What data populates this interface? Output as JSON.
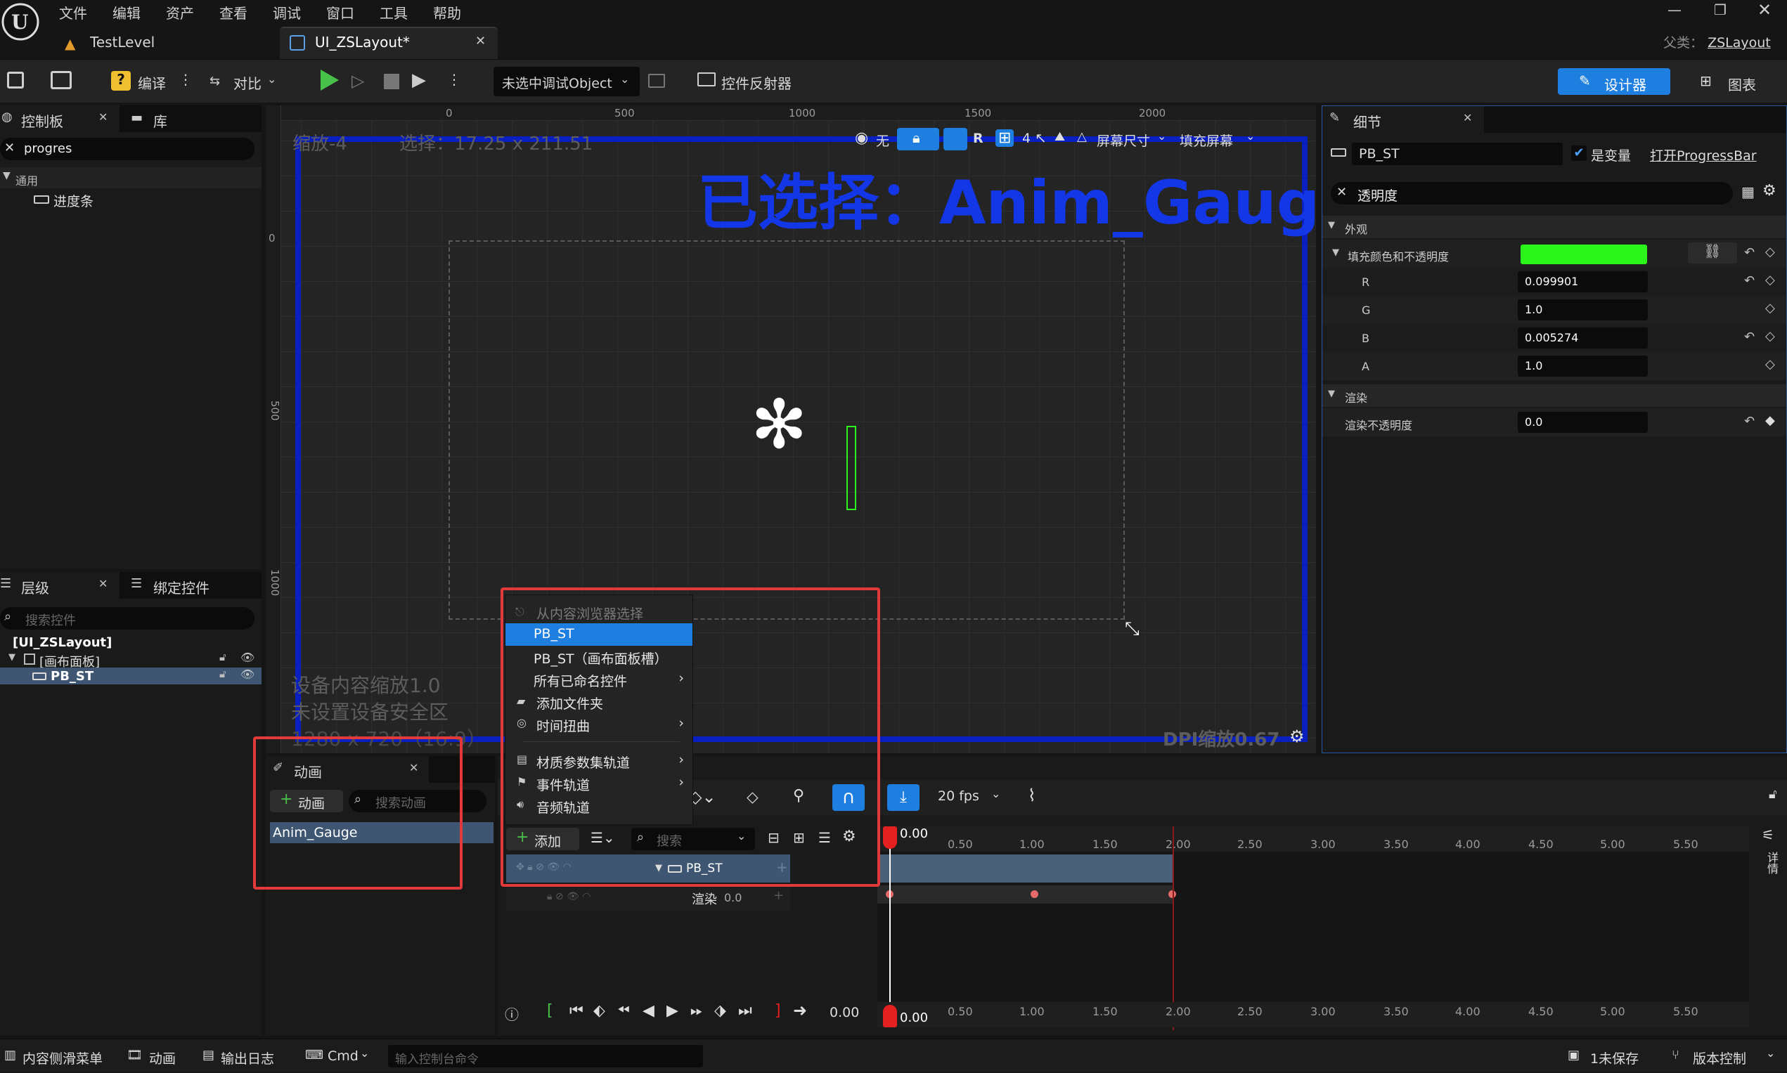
{
  "menu": [
    "文件",
    "编辑",
    "资产",
    "查看",
    "调试",
    "窗口",
    "工具",
    "帮助"
  ],
  "tabs": [
    {
      "label": "TestLevel"
    },
    {
      "label": "UI_ZSLayout*"
    }
  ],
  "parent": {
    "label": "父类：",
    "value": "ZSLayout"
  },
  "toolbar": {
    "compile": "编译",
    "diff": "对比",
    "debug_select": "未选中调试Object",
    "reflector": "控件反射器",
    "designer": "设计器",
    "graph": "图表"
  },
  "palette": {
    "tab": "控制板",
    "tab2": "库",
    "search_value": "progres",
    "category": "通用",
    "item": "进度条"
  },
  "hierarchy": {
    "tab": "层级",
    "tab2": "绑定控件",
    "search_placeholder": "搜索控件",
    "root": "[UI_ZSLayout]",
    "canvas": "[画布面板]",
    "item": "PB_ST"
  },
  "viewport": {
    "zoom": "缩放-4",
    "selection": "选择：17.25 x 211.51",
    "selected_big": "已选择：Anim_Gauge",
    "ruler_top": [
      "0",
      "500",
      "1000",
      "1500",
      "2000"
    ],
    "ruler_left": [
      "0",
      "500",
      "1000"
    ],
    "none_label": "无",
    "r_label": "R",
    "grid_num": "4",
    "screen_size": "屏幕尺寸",
    "fill_screen": "填充屏幕",
    "device_scale": "设备内容缩放1.0",
    "no_safe_zone": "未设置设备安全区",
    "resolution": "1280 x 720（16:9）",
    "dpi": "DPI缩放0.67"
  },
  "details": {
    "tab": "细节",
    "name": "PB_ST",
    "is_variable": "是变量",
    "open_link": "打开ProgressBar",
    "search_value": "透明度",
    "section_appearance": "外观",
    "fill_label": "填充颜色和不透明度",
    "fill_color": "#2bf51a",
    "r_label": "R",
    "r_value": "0.099901",
    "g_label": "G",
    "g_value": "1.0",
    "b_label": "B",
    "b_value": "0.005274",
    "a_label": "A",
    "a_value": "1.0",
    "section_render": "渲染",
    "opacity_label": "渲染不透明度",
    "opacity_value": "0.0"
  },
  "animation": {
    "tab": "动画",
    "add_label": "动画",
    "search_placeholder": "搜索动画",
    "item": "Anim_Gauge"
  },
  "context_menu": {
    "items": [
      {
        "label": "从内容浏览器选择",
        "state": "disabled"
      },
      {
        "label": "PB_ST",
        "state": "highlighted"
      },
      {
        "label": "PB_ST（画布面板槽）",
        "state": "normal"
      },
      {
        "label": "所有已命名控件",
        "state": "submenu"
      },
      {
        "label": "添加文件夹",
        "state": "normal"
      },
      {
        "label": "时间扭曲",
        "state": "submenu"
      },
      {
        "label": "材质参数集轨道",
        "state": "submenu"
      },
      {
        "label": "事件轨道",
        "state": "submenu"
      },
      {
        "label": "音频轨道",
        "state": "normal"
      }
    ]
  },
  "sequencer": {
    "add_label": "添加",
    "search_placeholder": "搜索",
    "fps": "20 fps",
    "track": "PB_ST",
    "sub_track": "渲染",
    "sub_value": "0.0",
    "time_start": "0.00",
    "current_time": "0.00",
    "ticks": [
      "0.50",
      "1.00",
      "1.50",
      "2.00",
      "2.50",
      "3.00",
      "3.50",
      "4.00",
      "4.50",
      "5.00",
      "5.50"
    ],
    "side_label": "详情"
  },
  "statusbar": {
    "drawer": "内容侧滑菜单",
    "anim": "动画",
    "log": "输出日志",
    "cmd": "Cmd",
    "cmd_placeholder": "输入控制台命令",
    "unsaved": "1未保存",
    "version": "版本控制"
  }
}
